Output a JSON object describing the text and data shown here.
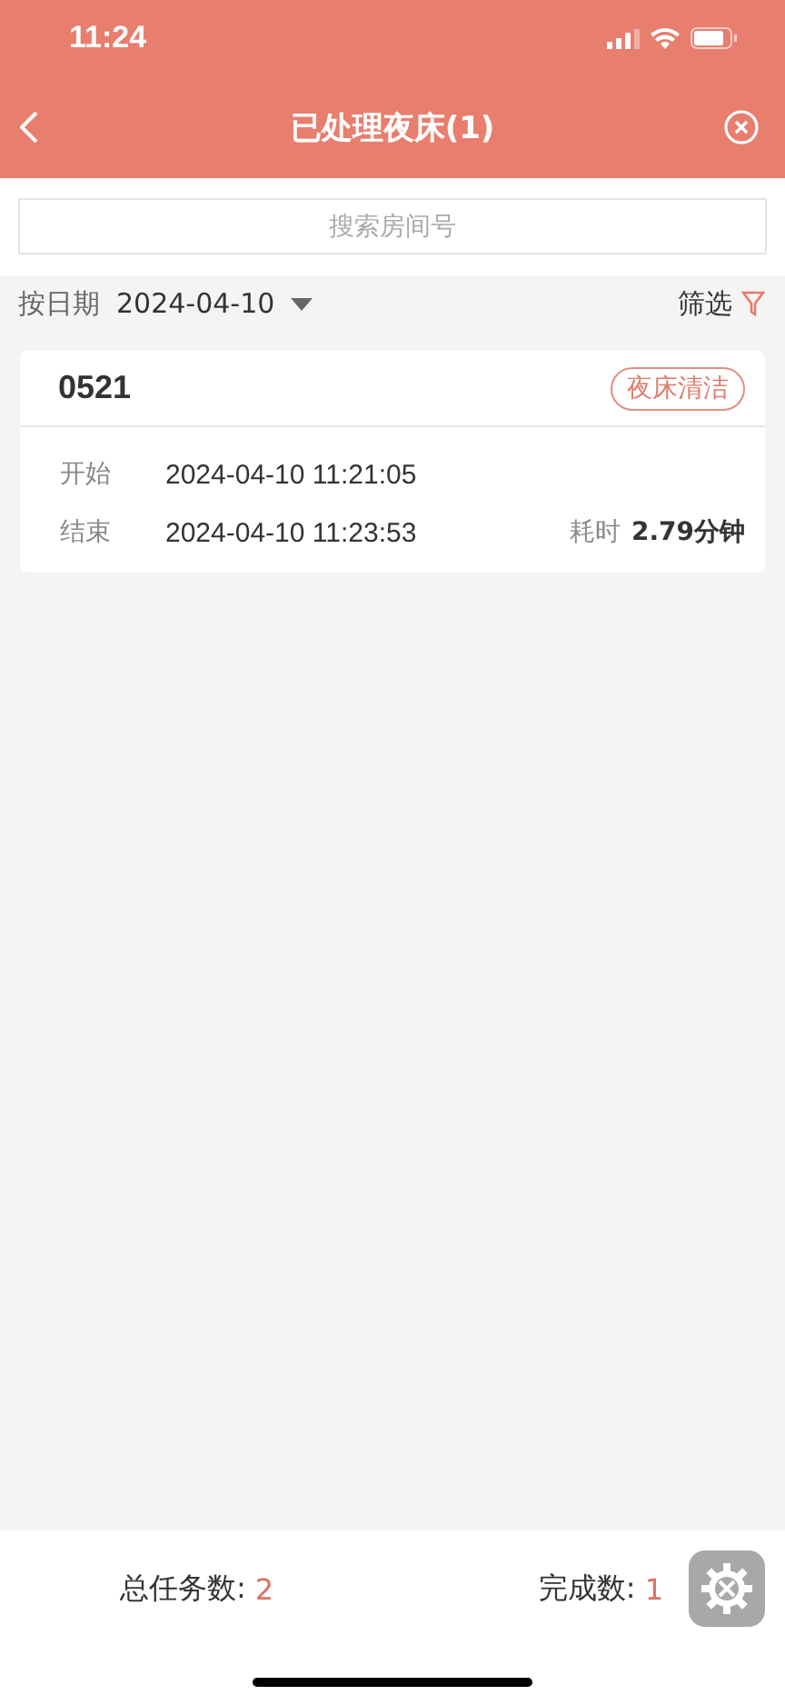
{
  "status_bar": {
    "time": "11:24"
  },
  "nav": {
    "title": "已处理夜床(1)"
  },
  "search": {
    "placeholder": "搜索房间号"
  },
  "filter_bar": {
    "date_label": "按日期",
    "date": "2024-04-10",
    "filter": "筛选"
  },
  "records": [
    {
      "room": "0521",
      "tag": "夜床清洁",
      "start_label": "开始",
      "start": "2024-04-10 11:21:05",
      "end_label": "结束",
      "end": "2024-04-10 11:23:53",
      "duration_label": "耗时",
      "duration": "2.79分钟"
    }
  ],
  "footer": {
    "stats": [
      {
        "label": "总任务数:",
        "value": "2"
      },
      {
        "label": "完成数:",
        "value": "1"
      }
    ]
  }
}
